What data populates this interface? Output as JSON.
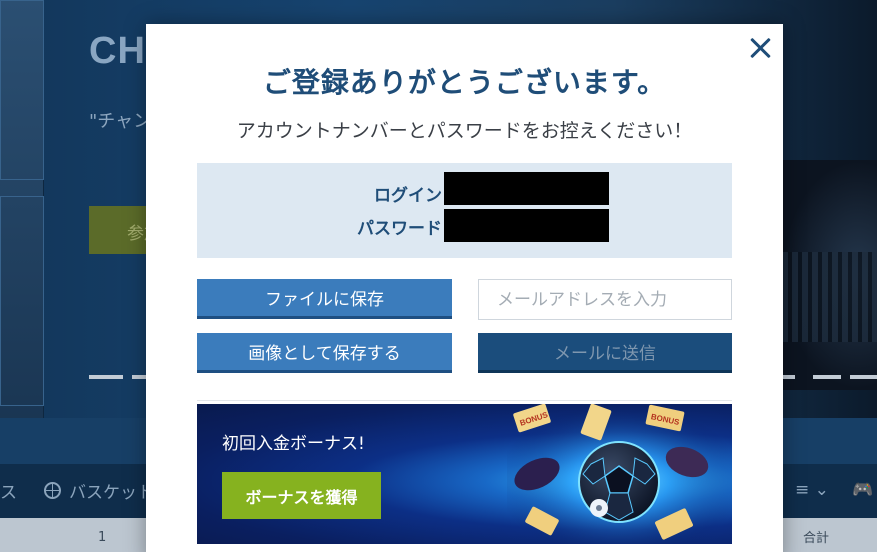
{
  "background": {
    "hero_title": "CHAMPIONS",
    "hero_text": "\"チャンピオンズリーグ\" レヴァンドフスキ",
    "join_button": "参加",
    "nav_partial": "ス",
    "nav_basketball": "バスケット",
    "menu_icon": "≡ ⌄",
    "game_icon": "🎮",
    "row_number": "1",
    "row_total": "合計"
  },
  "modal": {
    "title": "ご登録ありがとうございます。",
    "subtitle": "アカウントナンバーとパスワードをお控えください！",
    "login_label": "ログイン",
    "password_label": "パスワード",
    "save_file_label": "ファイルに保存",
    "save_image_label": "画像として保存する",
    "email_placeholder": "メールアドレスを入力",
    "email_value": "",
    "send_email_label": "メールに送信",
    "bonus": {
      "title": "初回入金ボーナス!",
      "button_label": "ボーナスを獲得",
      "ticket_text": "BONUS"
    }
  },
  "colors": {
    "accent_blue": "#3b7cbc",
    "title_blue": "#1f4d78",
    "bonus_green": "#86b21f"
  }
}
